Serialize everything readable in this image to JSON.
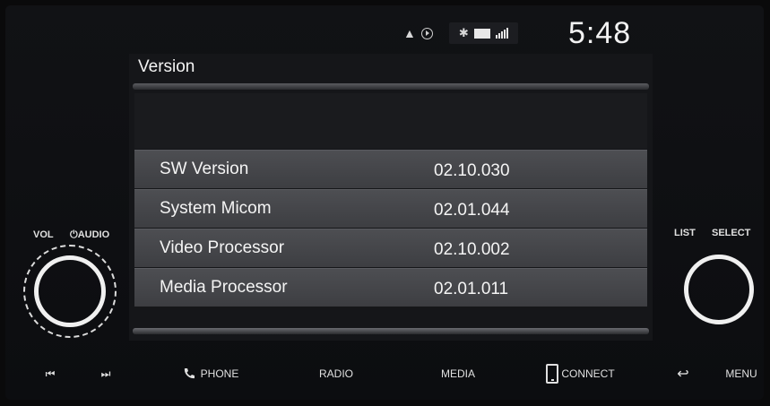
{
  "status": {
    "time": "5:48",
    "icons": [
      "navigation-icon",
      "clock-icon",
      "bluetooth-icon",
      "battery-icon",
      "signal-icon"
    ]
  },
  "screen": {
    "title": "Version",
    "rows": [
      {
        "label": "SW Version",
        "value": "02.10.030"
      },
      {
        "label": "System Micom",
        "value": "02.01.044"
      },
      {
        "label": "Video Processor",
        "value": "02.10.002"
      },
      {
        "label": "Media Processor",
        "value": "02.01.011"
      }
    ]
  },
  "knobs": {
    "left": {
      "vol_label": "VOL",
      "audio_label": "AUDIO"
    },
    "right": {
      "list_label": "LIST",
      "select_label": "SELECT"
    }
  },
  "buttons": {
    "seek_back": "⏮",
    "seek_forward": "⏭",
    "phone": "PHONE",
    "radio": "RADIO",
    "media": "MEDIA",
    "connect": "CONNECT",
    "menu": "MENU"
  },
  "colors": {
    "text": "#f3f3f3",
    "row_bg": "#46474b",
    "screen_bg": "#151619",
    "bezel": "#0c0d10"
  }
}
